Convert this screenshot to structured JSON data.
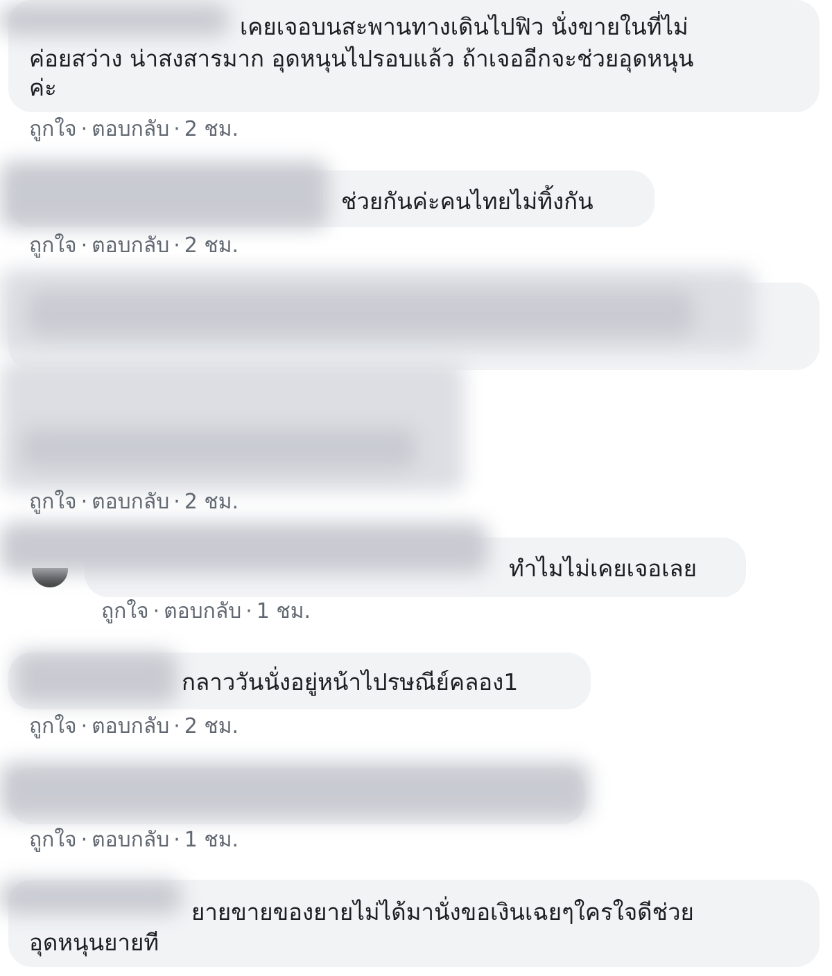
{
  "comments": [
    {
      "text_line1": "เคยเจอบนสะพานทางเดินไปฟิว นั่งขายในที่ไม่",
      "text_line2": "ค่อยสว่าง น่าสงสารมาก อุดหนุนไปรอบแล้ว ถ้าเจออีกจะช่วยอุดหนุน",
      "text_line3": "ค่ะ",
      "like": "ถูกใจ",
      "reply": "ตอบกลับ",
      "time": "2 ชม."
    },
    {
      "text": "ช่วยกันค่ะคนไทยไม่ทิ้งกัน",
      "like": "ถูกใจ",
      "reply": "ตอบกลับ",
      "time": "2 ชม."
    },
    {
      "text": "",
      "like": "ถูกใจ",
      "reply": "ตอบกลับ",
      "time": "2 ชม."
    },
    {
      "text": "ทำไมไม่เคยเจอเลย",
      "like": "ถูกใจ",
      "reply": "ตอบกลับ",
      "time": "1 ชม."
    },
    {
      "text": "กลาววันนั่งอยู่หน้าไปรษณีย์คลอง1",
      "like": "ถูกใจ",
      "reply": "ตอบกลับ",
      "time": "2 ชม."
    },
    {
      "text": "",
      "like": "ถูกใจ",
      "reply": "ตอบกลับ",
      "time": "1 ชม."
    },
    {
      "text_line1": "ยายขายของยายไม่ได้มานั่งขอเงินเฉยๆใครใจดีช่วย",
      "text_line2": "อุดหนุนยายที"
    }
  ],
  "sep": "·"
}
